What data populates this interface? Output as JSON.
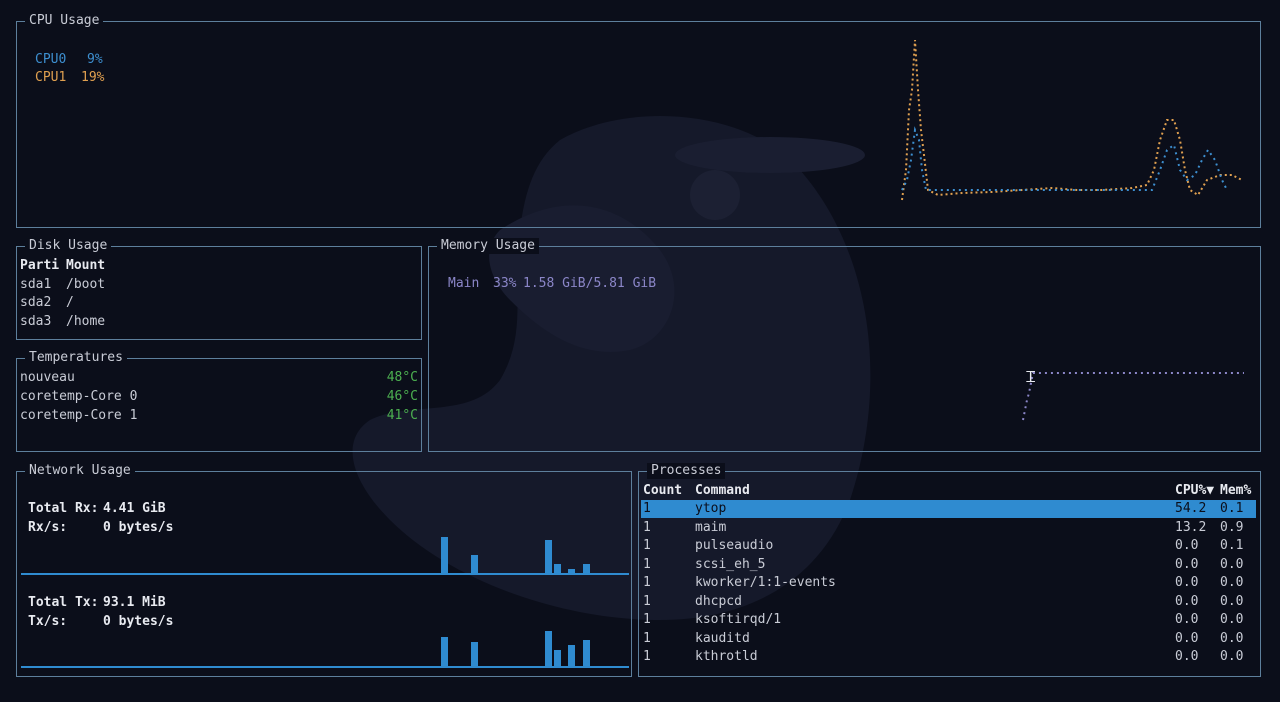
{
  "cpu": {
    "title": "CPU Usage",
    "cores": [
      {
        "label": "CPU0",
        "value": "9%",
        "color": "#3d8fd0"
      },
      {
        "label": "CPU1",
        "value": "19%",
        "color": "#e0a050"
      }
    ]
  },
  "disk": {
    "title": "Disk Usage",
    "headers": [
      "Parti",
      "Mount"
    ],
    "rows": [
      {
        "part": "sda1",
        "mount": "/boot"
      },
      {
        "part": "sda2",
        "mount": "/"
      },
      {
        "part": "sda3",
        "mount": "/home"
      }
    ]
  },
  "temps": {
    "title": "Temperatures",
    "rows": [
      {
        "name": "nouveau",
        "value": "48°C"
      },
      {
        "name": "coretemp-Core 0",
        "value": "46°C"
      },
      {
        "name": "coretemp-Core 1",
        "value": "41°C"
      }
    ]
  },
  "memory": {
    "title": "Memory Usage",
    "main_label": "Main",
    "main_percent": "33%",
    "main_value": "1.58 GiB/5.81 GiB",
    "color": "#8b86c8"
  },
  "network": {
    "title": "Network Usage",
    "rx_total_label": "Total Rx:",
    "rx_total": "4.41 GiB",
    "rx_rate_label": "Rx/s:",
    "rx_rate": "0 bytes/s",
    "tx_total_label": "Total Tx:",
    "tx_total": "93.1 MiB",
    "tx_rate_label": "Tx/s:",
    "tx_rate": "0 bytes/s"
  },
  "processes": {
    "title": "Processes",
    "headers": {
      "count": "Count",
      "command": "Command",
      "cpu": "CPU%▼",
      "mem": "Mem%"
    },
    "rows": [
      {
        "count": "1",
        "command": "ytop",
        "cpu": "54.2",
        "mem": "0.1",
        "selected": true
      },
      {
        "count": "1",
        "command": "maim",
        "cpu": "13.2",
        "mem": "0.9"
      },
      {
        "count": "1",
        "command": "pulseaudio",
        "cpu": "0.0",
        "mem": "0.1"
      },
      {
        "count": "1",
        "command": "scsi_eh_5",
        "cpu": "0.0",
        "mem": "0.0"
      },
      {
        "count": "1",
        "command": "kworker/1:1-events",
        "cpu": "0.0",
        "mem": "0.0"
      },
      {
        "count": "1",
        "command": "dhcpcd",
        "cpu": "0.0",
        "mem": "0.0"
      },
      {
        "count": "1",
        "command": "ksoftirqd/1",
        "cpu": "0.0",
        "mem": "0.0"
      },
      {
        "count": "1",
        "command": "kauditd",
        "cpu": "0.0",
        "mem": "0.0"
      },
      {
        "count": "1",
        "command": "kthrotld",
        "cpu": "0.0",
        "mem": "0.0"
      }
    ]
  },
  "colors": {
    "border": "#5d7f9c",
    "accent": "#2f8bd0",
    "background": "#0b0e1a"
  }
}
